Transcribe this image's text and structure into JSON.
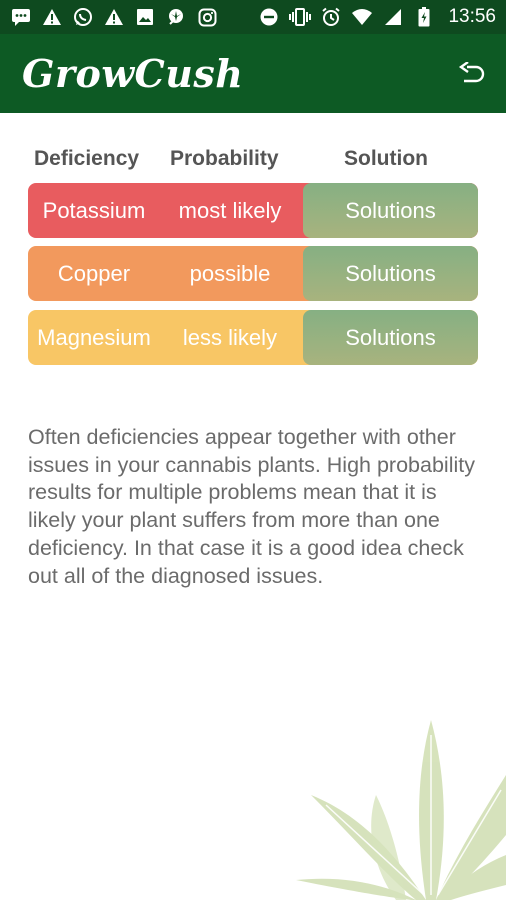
{
  "status_bar": {
    "time": "13:56",
    "left_icons": [
      "chat-icon",
      "warning-icon",
      "whatsapp-icon",
      "warning-icon",
      "image-icon",
      "weed-app-icon",
      "instagram-icon"
    ],
    "right_icons": [
      "dnd-icon",
      "vibrate-icon",
      "alarm-icon",
      "wifi-icon",
      "signal-icon",
      "battery-charging-icon"
    ]
  },
  "app_bar": {
    "title": "GrowCush"
  },
  "table": {
    "headers": {
      "deficiency": "Deficiency",
      "probability": "Probability",
      "solution": "Solution"
    },
    "rows": [
      {
        "deficiency": "Potassium",
        "probability": "most likely",
        "solution": "Solutions",
        "color": "#e85c5f"
      },
      {
        "deficiency": "Copper",
        "probability": "possible",
        "solution": "Solutions",
        "color": "#f2995d"
      },
      {
        "deficiency": "Magnesium",
        "probability": "less likely",
        "solution": "Solutions",
        "color": "#f8c665"
      }
    ]
  },
  "description": "Often deficiencies appear together with other issues in your cannabis plants. High probability results for multiple problems mean that it is likely your plant suffers from more than one deficiency. In that case it is a good idea check out all of the diagnosed issues.",
  "colors": {
    "status_bar": "#0e4a1f",
    "app_bar": "#0d5a24",
    "solution_button": "#93b281"
  }
}
